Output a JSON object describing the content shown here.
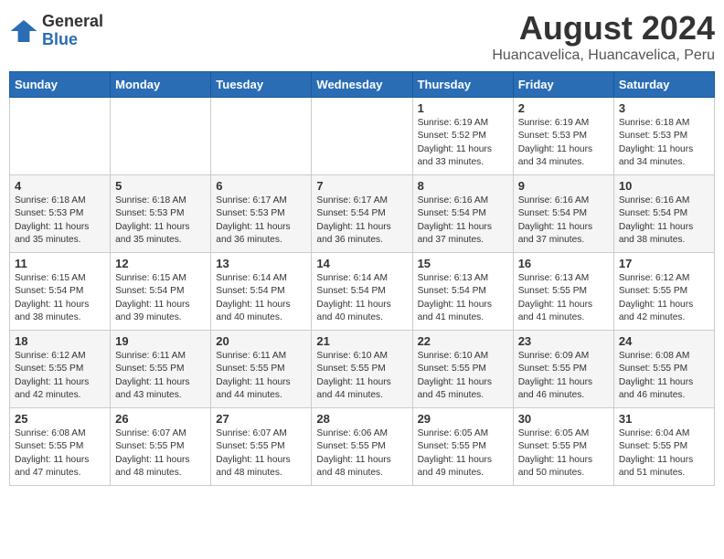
{
  "logo": {
    "general": "General",
    "blue": "Blue"
  },
  "title": {
    "month_year": "August 2024",
    "location": "Huancavelica, Huancavelica, Peru"
  },
  "days_of_week": [
    "Sunday",
    "Monday",
    "Tuesday",
    "Wednesday",
    "Thursday",
    "Friday",
    "Saturday"
  ],
  "weeks": [
    [
      {
        "day": "",
        "content": ""
      },
      {
        "day": "",
        "content": ""
      },
      {
        "day": "",
        "content": ""
      },
      {
        "day": "",
        "content": ""
      },
      {
        "day": "1",
        "content": "Sunrise: 6:19 AM\nSunset: 5:52 PM\nDaylight: 11 hours\nand 33 minutes."
      },
      {
        "day": "2",
        "content": "Sunrise: 6:19 AM\nSunset: 5:53 PM\nDaylight: 11 hours\nand 34 minutes."
      },
      {
        "day": "3",
        "content": "Sunrise: 6:18 AM\nSunset: 5:53 PM\nDaylight: 11 hours\nand 34 minutes."
      }
    ],
    [
      {
        "day": "4",
        "content": "Sunrise: 6:18 AM\nSunset: 5:53 PM\nDaylight: 11 hours\nand 35 minutes."
      },
      {
        "day": "5",
        "content": "Sunrise: 6:18 AM\nSunset: 5:53 PM\nDaylight: 11 hours\nand 35 minutes."
      },
      {
        "day": "6",
        "content": "Sunrise: 6:17 AM\nSunset: 5:53 PM\nDaylight: 11 hours\nand 36 minutes."
      },
      {
        "day": "7",
        "content": "Sunrise: 6:17 AM\nSunset: 5:54 PM\nDaylight: 11 hours\nand 36 minutes."
      },
      {
        "day": "8",
        "content": "Sunrise: 6:16 AM\nSunset: 5:54 PM\nDaylight: 11 hours\nand 37 minutes."
      },
      {
        "day": "9",
        "content": "Sunrise: 6:16 AM\nSunset: 5:54 PM\nDaylight: 11 hours\nand 37 minutes."
      },
      {
        "day": "10",
        "content": "Sunrise: 6:16 AM\nSunset: 5:54 PM\nDaylight: 11 hours\nand 38 minutes."
      }
    ],
    [
      {
        "day": "11",
        "content": "Sunrise: 6:15 AM\nSunset: 5:54 PM\nDaylight: 11 hours\nand 38 minutes."
      },
      {
        "day": "12",
        "content": "Sunrise: 6:15 AM\nSunset: 5:54 PM\nDaylight: 11 hours\nand 39 minutes."
      },
      {
        "day": "13",
        "content": "Sunrise: 6:14 AM\nSunset: 5:54 PM\nDaylight: 11 hours\nand 40 minutes."
      },
      {
        "day": "14",
        "content": "Sunrise: 6:14 AM\nSunset: 5:54 PM\nDaylight: 11 hours\nand 40 minutes."
      },
      {
        "day": "15",
        "content": "Sunrise: 6:13 AM\nSunset: 5:54 PM\nDaylight: 11 hours\nand 41 minutes."
      },
      {
        "day": "16",
        "content": "Sunrise: 6:13 AM\nSunset: 5:55 PM\nDaylight: 11 hours\nand 41 minutes."
      },
      {
        "day": "17",
        "content": "Sunrise: 6:12 AM\nSunset: 5:55 PM\nDaylight: 11 hours\nand 42 minutes."
      }
    ],
    [
      {
        "day": "18",
        "content": "Sunrise: 6:12 AM\nSunset: 5:55 PM\nDaylight: 11 hours\nand 42 minutes."
      },
      {
        "day": "19",
        "content": "Sunrise: 6:11 AM\nSunset: 5:55 PM\nDaylight: 11 hours\nand 43 minutes."
      },
      {
        "day": "20",
        "content": "Sunrise: 6:11 AM\nSunset: 5:55 PM\nDaylight: 11 hours\nand 44 minutes."
      },
      {
        "day": "21",
        "content": "Sunrise: 6:10 AM\nSunset: 5:55 PM\nDaylight: 11 hours\nand 44 minutes."
      },
      {
        "day": "22",
        "content": "Sunrise: 6:10 AM\nSunset: 5:55 PM\nDaylight: 11 hours\nand 45 minutes."
      },
      {
        "day": "23",
        "content": "Sunrise: 6:09 AM\nSunset: 5:55 PM\nDaylight: 11 hours\nand 46 minutes."
      },
      {
        "day": "24",
        "content": "Sunrise: 6:08 AM\nSunset: 5:55 PM\nDaylight: 11 hours\nand 46 minutes."
      }
    ],
    [
      {
        "day": "25",
        "content": "Sunrise: 6:08 AM\nSunset: 5:55 PM\nDaylight: 11 hours\nand 47 minutes."
      },
      {
        "day": "26",
        "content": "Sunrise: 6:07 AM\nSunset: 5:55 PM\nDaylight: 11 hours\nand 48 minutes."
      },
      {
        "day": "27",
        "content": "Sunrise: 6:07 AM\nSunset: 5:55 PM\nDaylight: 11 hours\nand 48 minutes."
      },
      {
        "day": "28",
        "content": "Sunrise: 6:06 AM\nSunset: 5:55 PM\nDaylight: 11 hours\nand 48 minutes."
      },
      {
        "day": "29",
        "content": "Sunrise: 6:05 AM\nSunset: 5:55 PM\nDaylight: 11 hours\nand 49 minutes."
      },
      {
        "day": "30",
        "content": "Sunrise: 6:05 AM\nSunset: 5:55 PM\nDaylight: 11 hours\nand 50 minutes."
      },
      {
        "day": "31",
        "content": "Sunrise: 6:04 AM\nSunset: 5:55 PM\nDaylight: 11 hours\nand 51 minutes."
      }
    ]
  ]
}
